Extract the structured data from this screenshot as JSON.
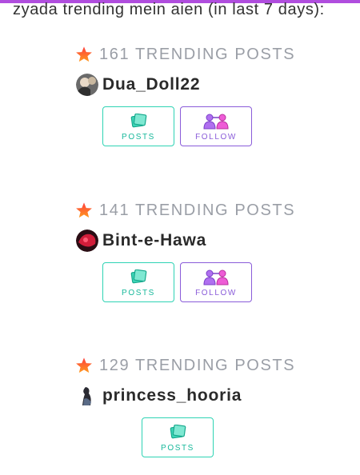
{
  "intro_text": "zyada trending mein aien (in last 7 days):",
  "entries": [
    {
      "trending_text": "161 TRENDING POSTS",
      "username": "Dua_Doll22",
      "posts_label": "POSTS",
      "follow_label": "FOLLOW"
    },
    {
      "trending_text": "141 TRENDING POSTS",
      "username": "Bint-e-Hawa",
      "posts_label": "POSTS",
      "follow_label": "FOLLOW"
    },
    {
      "trending_text": "129 TRENDING POSTS",
      "username": "princess_hooria",
      "posts_label": "POSTS"
    }
  ],
  "colors": {
    "accent_bar": "#b04dde",
    "posts_border": "#2fd3b4",
    "follow_border": "#8a5cd9",
    "trending_text": "#9a9ea6",
    "star": "#f05a28"
  },
  "icons": {
    "trending": "star-icon",
    "posts": "notes-icon",
    "follow": "people-link-icon"
  }
}
